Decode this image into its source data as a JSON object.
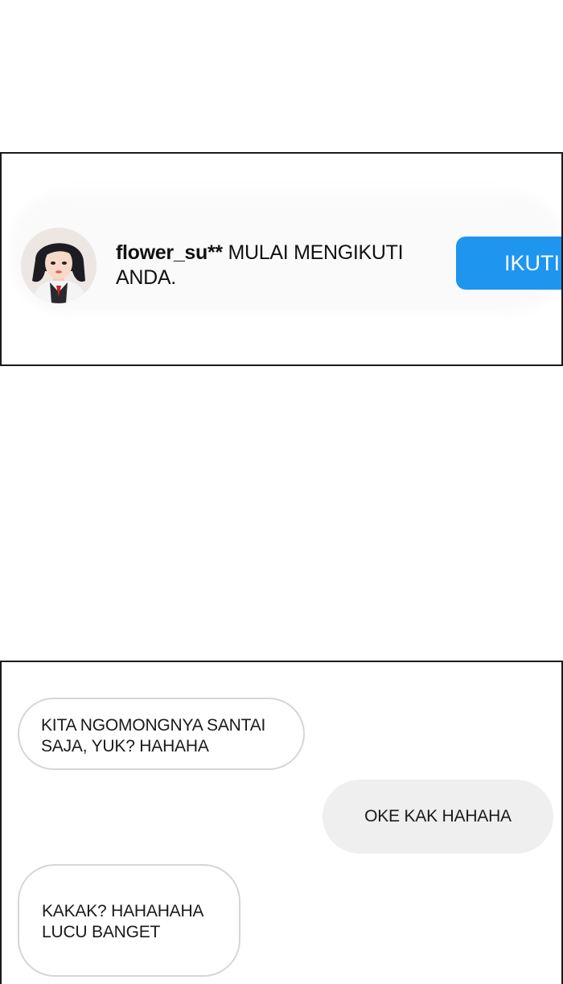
{
  "notification": {
    "username": "flower_su**",
    "message_line1": "MULAI MENGIKUTI",
    "message_line2": "ANDA.",
    "follow_button_label": "IKUTI",
    "accent_color": "#1e96f0"
  },
  "chat": {
    "messages": [
      {
        "side": "incoming",
        "lines": [
          "KITA NGOMONGNYA SANTAI",
          "SAJA, YUK? HAHAHA"
        ]
      },
      {
        "side": "outgoing",
        "lines": [
          "OKE KAK HAHAHA"
        ]
      },
      {
        "side": "incoming",
        "lines": [
          "KAKAK? HAHAHAHA",
          "LUCU BANGET"
        ]
      }
    ]
  }
}
